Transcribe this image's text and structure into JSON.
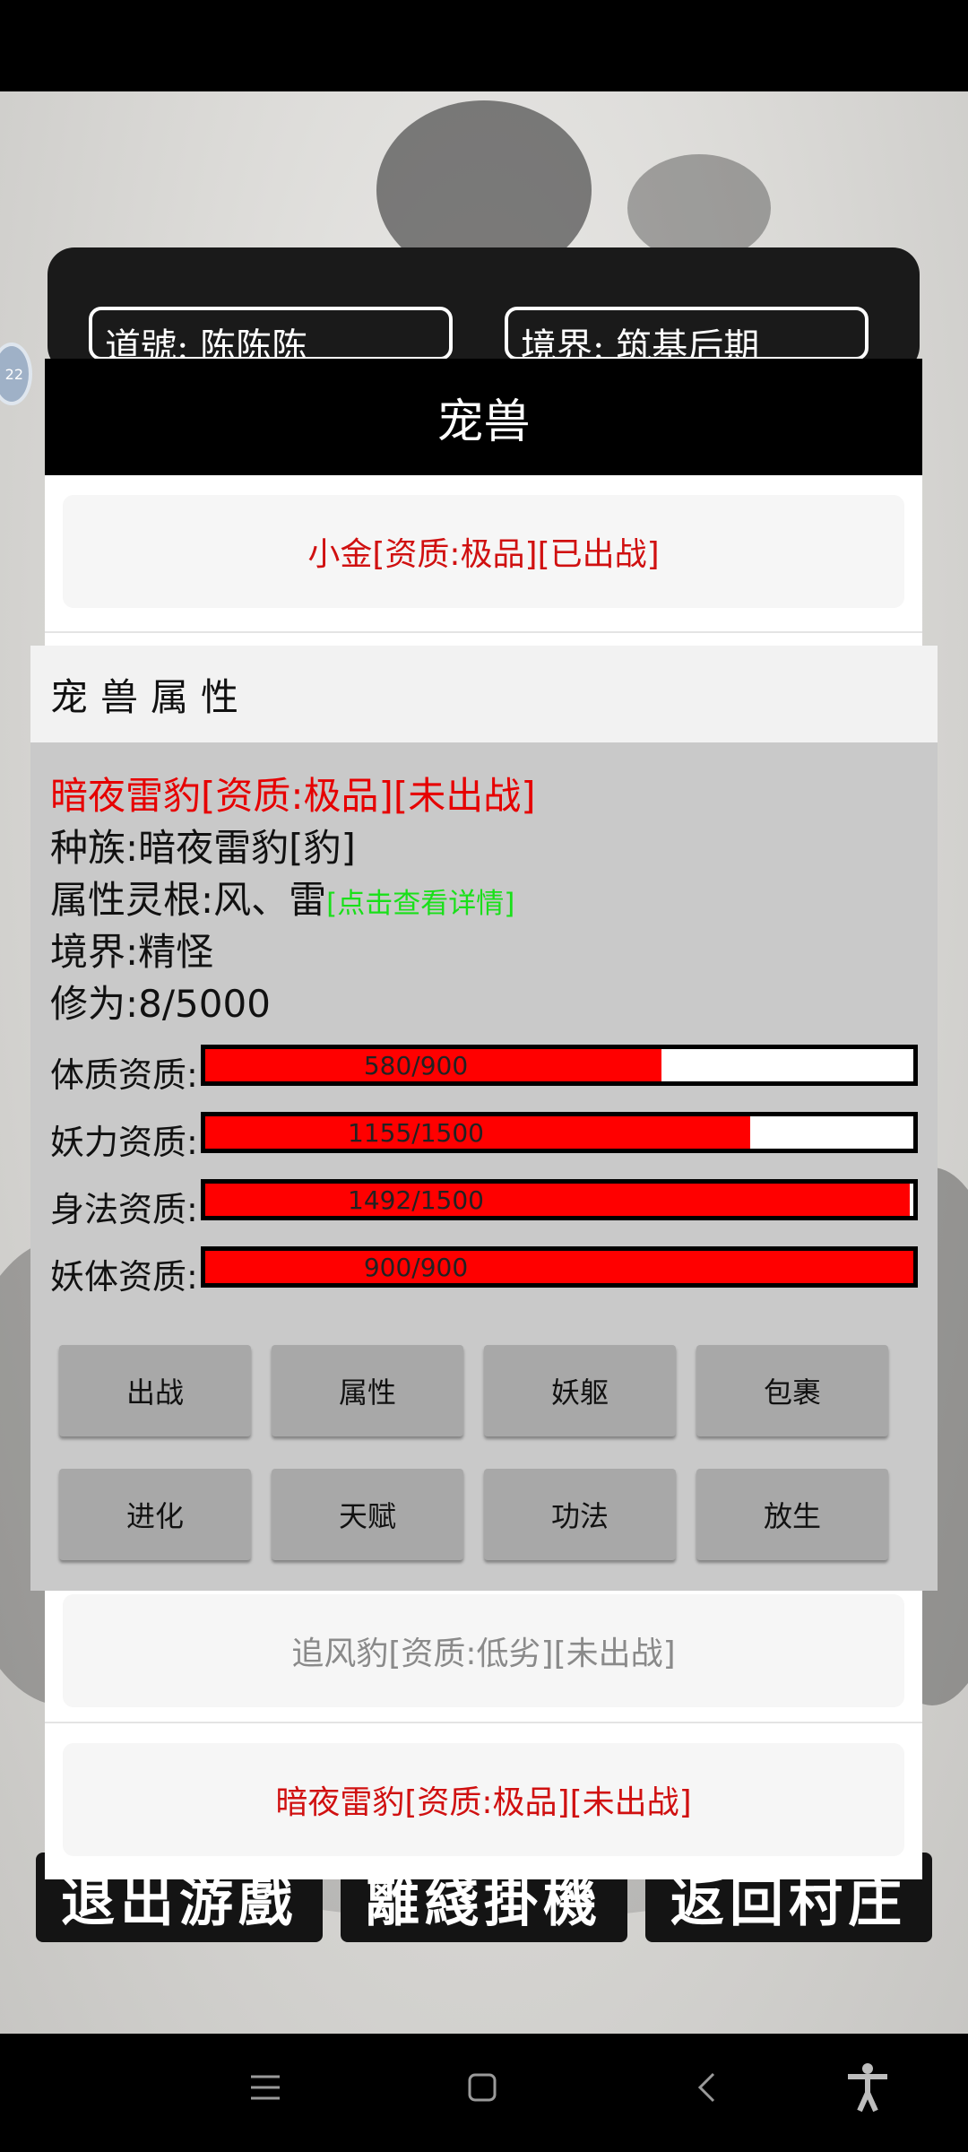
{
  "character": {
    "dao_label": "道號: 陈陈陈",
    "realm_label": "境界: 筑基后期",
    "bubble": "22"
  },
  "pet_dialog": {
    "title": "宠兽",
    "pets": [
      {
        "label": "小金[资质:极品][已出战]",
        "color": "#d01010"
      },
      {
        "label": "追风豹[资质:低劣][未出战]",
        "color": "#8a8a8a"
      },
      {
        "label": "暗夜雷豹[资质:极品][未出战]",
        "color": "#d01010"
      }
    ]
  },
  "attributes": {
    "title": "宠兽属性",
    "name_line": "暗夜雷豹[资质:极品][未出战]",
    "race": "种族:暗夜雷豹[豹]",
    "root": "属性灵根:风、雷",
    "root_link": "[点击查看详情]",
    "realm": "境界:精怪",
    "cultivation": "修为:8/5000",
    "stats": [
      {
        "label": "体质资质:",
        "text": "580/900",
        "value": 580,
        "max": 900
      },
      {
        "label": "妖力资质:",
        "text": "1155/1500",
        "value": 1155,
        "max": 1500
      },
      {
        "label": "身法资质:",
        "text": "1492/1500",
        "value": 1492,
        "max": 1500
      },
      {
        "label": "妖体资质:",
        "text": "900/900",
        "value": 900,
        "max": 900
      }
    ],
    "buttons_row1": [
      "出战",
      "属性",
      "妖躯",
      "包裹"
    ],
    "buttons_row2": [
      "进化",
      "天赋",
      "功法",
      "放生"
    ]
  },
  "bottom_buttons": [
    "退出游戲",
    "離綫掛機",
    "返回村庄"
  ],
  "colors": {
    "bar_fill": "#ff0000",
    "red_text": "#e60000",
    "link_green": "#19e019"
  }
}
